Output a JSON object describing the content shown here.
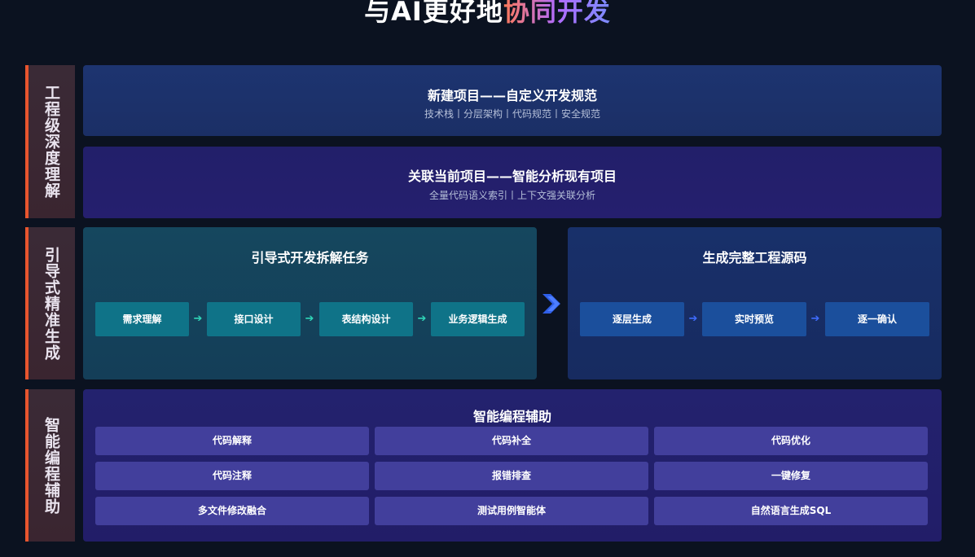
{
  "title": {
    "main": "与AI更好地",
    "highlight": "协同开发"
  },
  "sections": [
    {
      "label": "工程级深度理解"
    },
    {
      "label": "引导式精准生成"
    },
    {
      "label": "智能编程辅助"
    }
  ],
  "understanding": {
    "new_project": {
      "title": "新建项目——自定义开发规范",
      "subtitle": "技术栈丨分层架构丨代码规范丨安全规范"
    },
    "link_project": {
      "title": "关联当前项目——智能分析现有项目",
      "subtitle": "全量代码语义索引丨上下文强关联分析"
    }
  },
  "guided": {
    "left_title": "引导式开发拆解任务",
    "left_steps": [
      "需求理解",
      "接口设计",
      "表结构设计",
      "业务逻辑生成"
    ],
    "right_title": "生成完整工程源码",
    "right_steps": [
      "逐层生成",
      "实时预览",
      "逐一确认"
    ]
  },
  "assist": {
    "title": "智能编程辅助",
    "features": [
      "代码解释",
      "代码补全",
      "代码优化",
      "代码注释",
      "报错排查",
      "一键修复",
      "多文件修改融合",
      "测试用例智能体",
      "自然语言生成SQL"
    ]
  },
  "colors": {
    "accent": "#e8552e",
    "teal_arrow": "#2fd6b8",
    "blue_arrow": "#3f6cff"
  }
}
